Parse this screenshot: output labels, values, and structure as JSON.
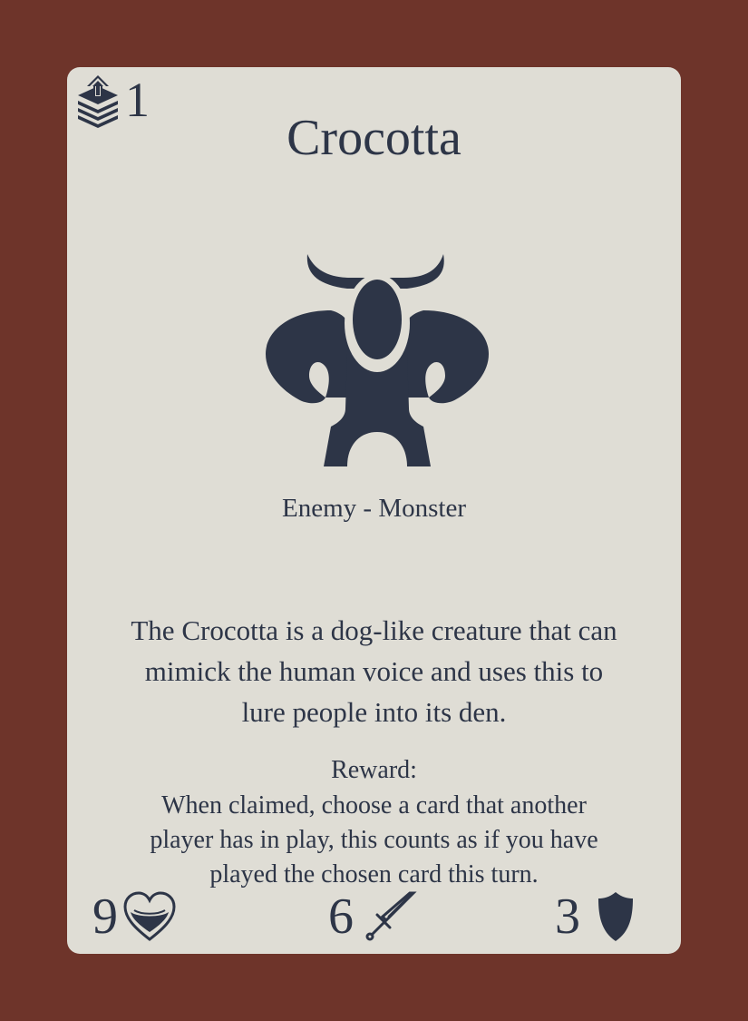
{
  "card": {
    "cost": "1",
    "cost_icon": "stack-up-icon",
    "title": "Crocotta",
    "art_icon": "horned-monster-icon",
    "type_line": "Enemy - Monster",
    "flavor_lines": [
      "The Crocotta is a dog-like creature that can",
      "mimick the human voice and uses this to",
      "lure people into its den."
    ],
    "reward_title": "Reward:",
    "reward_lines": [
      "When claimed, choose a card that another",
      "player has in play, this counts as if you have",
      "played the chosen card this turn."
    ],
    "stats": {
      "health": {
        "value": "9",
        "icon": "heart-icon"
      },
      "attack": {
        "value": "6",
        "icon": "sword-icon"
      },
      "defense": {
        "value": "3",
        "icon": "shield-icon"
      }
    }
  },
  "colors": {
    "background": "#6e342a",
    "card": "#dfddd5",
    "ink": "#2d3547"
  }
}
